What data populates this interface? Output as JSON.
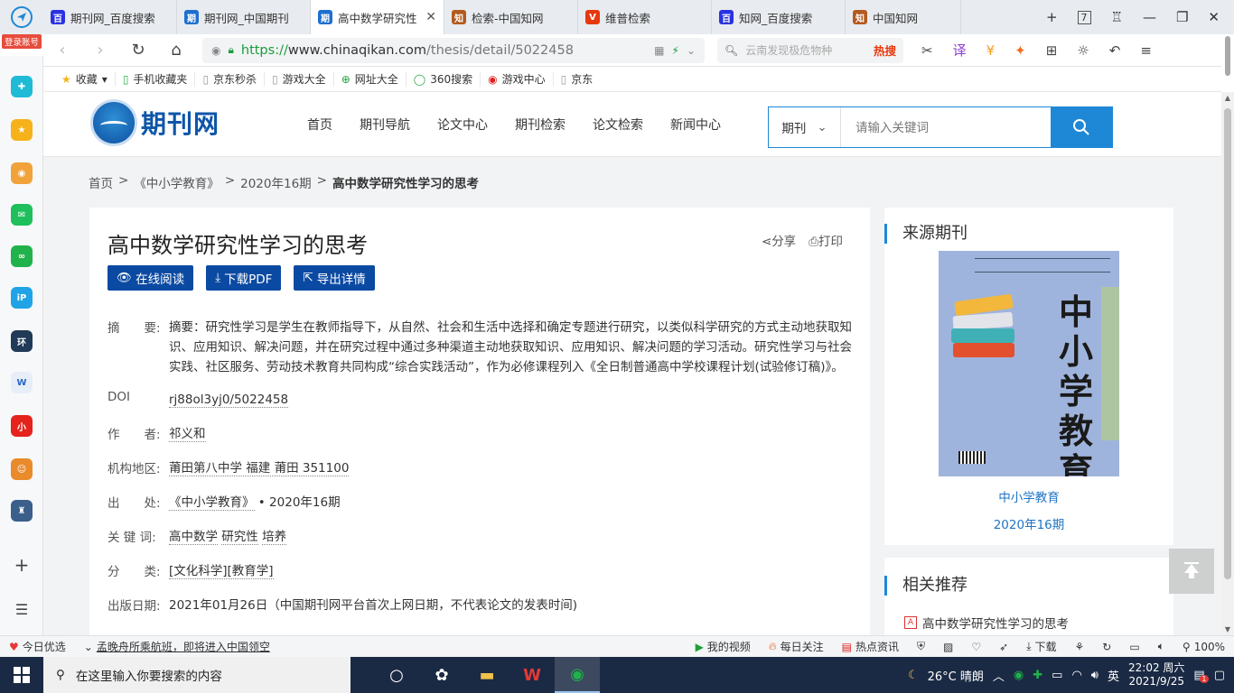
{
  "browser": {
    "tabs": [
      {
        "title": "期刊网_百度搜索",
        "icon": "baidu-icon",
        "color": "#2932e1"
      },
      {
        "title": "期刊网_中国期刊",
        "icon": "qikan-icon",
        "color": "#1e6fd0"
      },
      {
        "title": "高中数学研究性",
        "icon": "qikan-icon",
        "color": "#1e6fd0",
        "active": true
      },
      {
        "title": "检索-中国知网",
        "icon": "cnki-icon",
        "color": "#b35a1f"
      },
      {
        "title": "维普检索",
        "icon": "vip-icon",
        "color": "#e8380d"
      },
      {
        "title": "知网_百度搜索",
        "icon": "baidu-icon",
        "color": "#2932e1"
      },
      {
        "title": "中国知网",
        "icon": "cnki-icon",
        "color": "#b35a1f"
      }
    ],
    "tab_count": "7",
    "url_scheme": "https://",
    "url_host": "www.chinaqikan.com",
    "url_path": "/thesis/detail/5022458",
    "search_placeholder": "云南发现极危物种",
    "search_hot": "热搜",
    "bookmarks": [
      {
        "label": "收藏",
        "icon": "star-icon"
      },
      {
        "label": "手机收藏夹",
        "icon": "phone-icon"
      },
      {
        "label": "京东秒杀",
        "icon": "page-icon"
      },
      {
        "label": "游戏大全",
        "icon": "page-icon"
      },
      {
        "label": "网址大全",
        "icon": "globe-icon"
      },
      {
        "label": "360搜索",
        "icon": "so360-icon"
      },
      {
        "label": "游戏中心",
        "icon": "game-icon"
      },
      {
        "label": "京东",
        "icon": "page-icon"
      }
    ],
    "login_label": "登录账号"
  },
  "site": {
    "brand": "期刊网",
    "nav": [
      "首页",
      "期刊导航",
      "论文中心",
      "期刊检索",
      "论文检索",
      "新闻中心"
    ],
    "search": {
      "category": "期刊",
      "placeholder": "请输入关键词"
    }
  },
  "breadcrumb": [
    "首页",
    "《中小学教育》",
    "2020年16期",
    "高中数学研究性学习的思考"
  ],
  "article": {
    "title": "高中数学研究性学习的思考",
    "share": "分享",
    "print": "打印",
    "buttons": [
      "在线阅读",
      "下载PDF",
      "导出详情"
    ],
    "abstract_label": "摘　　要:",
    "abstract": "摘要：研究性学习是学生在教师指导下，从自然、社会和生活中选择和确定专题进行研究，以类似科学研究的方式主动地获取知识、应用知识、解决问题，并在研究过程中通过多种渠道主动地获取知识、应用知识、解决问题的学习活动。研究性学习与社会实践、社区服务、劳动技术教育共同构成“综合实践活动”，作为必修课程列入《全日制普通高中学校课程计划(试验修订稿)》。",
    "doi_label": "DOI",
    "doi": "rj88ol3yj0/5022458",
    "author_label": "作　　者:",
    "author": "祁义和",
    "org_label": "机构地区:",
    "org": "莆田第八中学 福建 莆田 351100",
    "source_label": "出　　处:",
    "source_journal": "《中小学教育》",
    "source_issue": "• 2020年16期",
    "keywords_label": "关  键  词:",
    "keywords": [
      "高中数学",
      "研究性",
      "培养"
    ],
    "class_label": "分　　类:",
    "class": "[文化科学][教育学]",
    "pubdate_label": "出版日期:",
    "pubdate": "2021年01月26日（中国期刊网平台首次上网日期，不代表论文的发表时间)"
  },
  "sidebar": {
    "source_heading": "来源期刊",
    "journal_name": "中小学教育",
    "journal_issue": "2020年16期",
    "cover_title": "中小学教育",
    "related_heading": "相关推荐",
    "related": [
      "高中数学研究性学习的思考"
    ]
  },
  "statusbar": {
    "left": [
      "今日优选",
      "孟晚舟所乘航班，即将进入中国领空"
    ],
    "right": [
      "我的视频",
      "每日关注",
      "热点资讯",
      "下载",
      "100%"
    ]
  },
  "taskbar": {
    "search_placeholder": "在这里输入你要搜索的内容",
    "weather": "26°C  晴朗",
    "ime": "英",
    "time": "22:02 周六",
    "date": "2021/9/25",
    "notif_count": "1"
  }
}
